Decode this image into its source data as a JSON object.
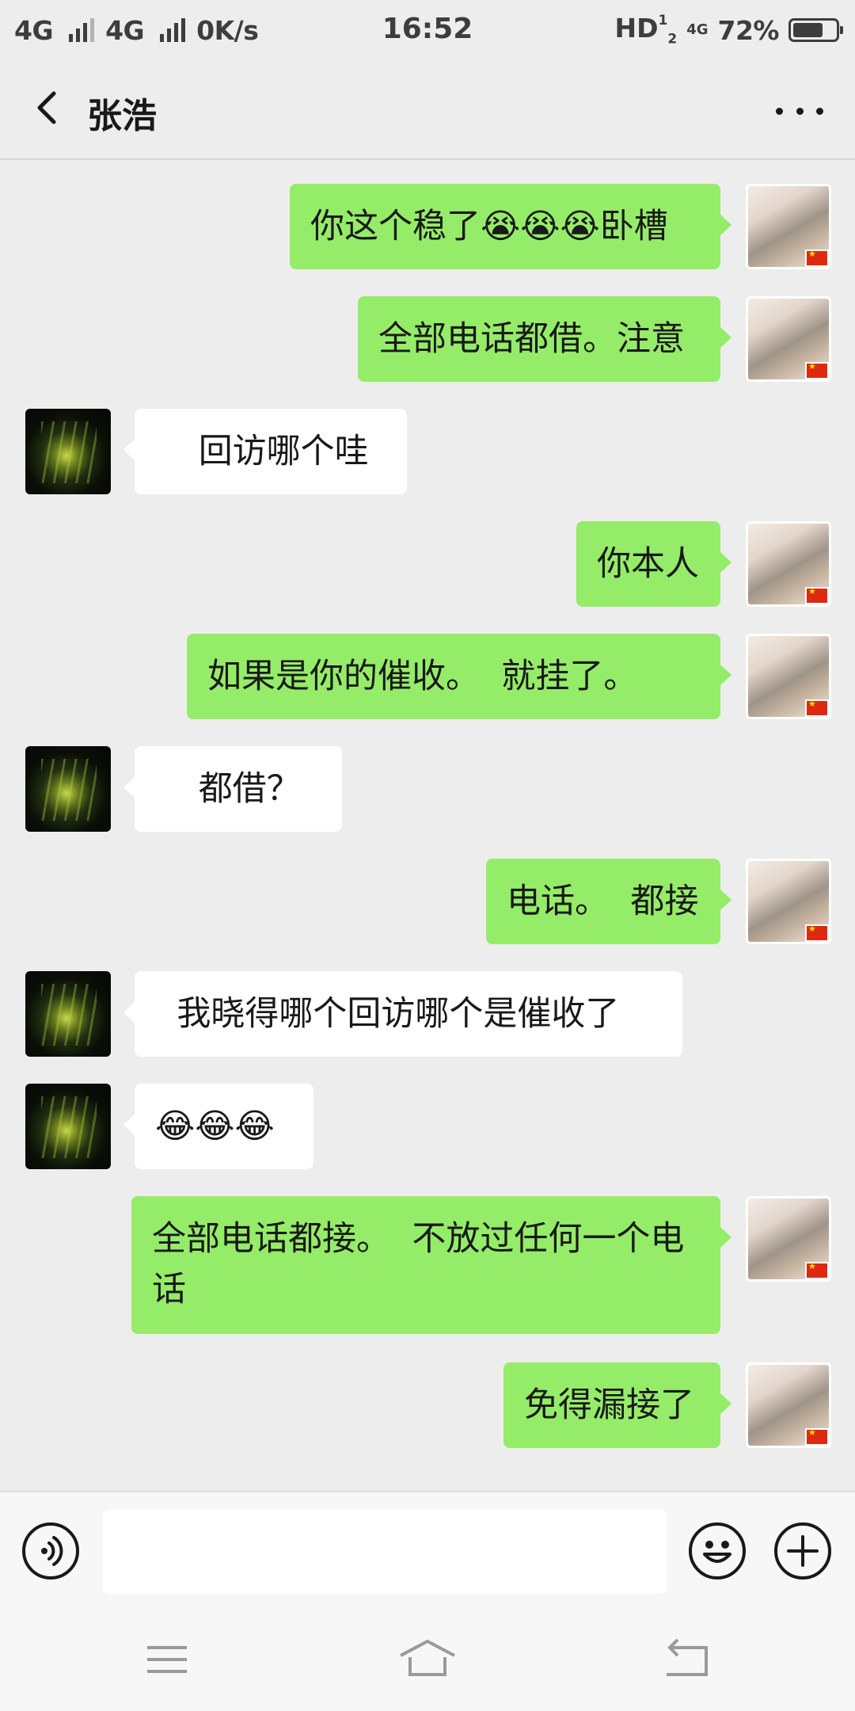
{
  "status_bar": {
    "network_1": "4G",
    "network_2": "4G",
    "speed": "0K/s",
    "time": "16:52",
    "hd_label": "HD",
    "hd_sup": "1",
    "hd_sub": "2",
    "small_network": "4G",
    "battery_percent": "72%",
    "battery_level": 0.72
  },
  "header": {
    "title": "张浩"
  },
  "messages": [
    {
      "from": "me",
      "text": "你这个稳了😭😭😭卧槽"
    },
    {
      "from": "me",
      "text": "全部电话都借。注意"
    },
    {
      "from": "them",
      "text": "    回访哪个哇"
    },
    {
      "from": "me",
      "text": "你本人"
    },
    {
      "from": "me",
      "text": "如果是你的催收。  就挂了。"
    },
    {
      "from": "them",
      "text": "    都借？"
    },
    {
      "from": "me",
      "text": "电话。  都接"
    },
    {
      "from": "them",
      "text": "  我晓得哪个回访哪个是催收了"
    },
    {
      "from": "them",
      "text": "😂😂😂"
    },
    {
      "from": "me",
      "text": "全部电话都接。  不放过任何一个电话"
    },
    {
      "from": "me",
      "text": "免得漏接了"
    }
  ],
  "input": {
    "value": "",
    "placeholder": ""
  },
  "icons": {
    "back": "chevron-left-icon",
    "more": "more-dots-icon",
    "voice": "voice-icon",
    "emoji": "smiley-icon",
    "plus": "plus-icon",
    "menu": "menu-lines-icon",
    "home": "home-icon",
    "return": "return-icon"
  },
  "colors": {
    "my_bubble": "#95ec69",
    "their_bubble": "#ffffff",
    "background": "#ededed"
  }
}
